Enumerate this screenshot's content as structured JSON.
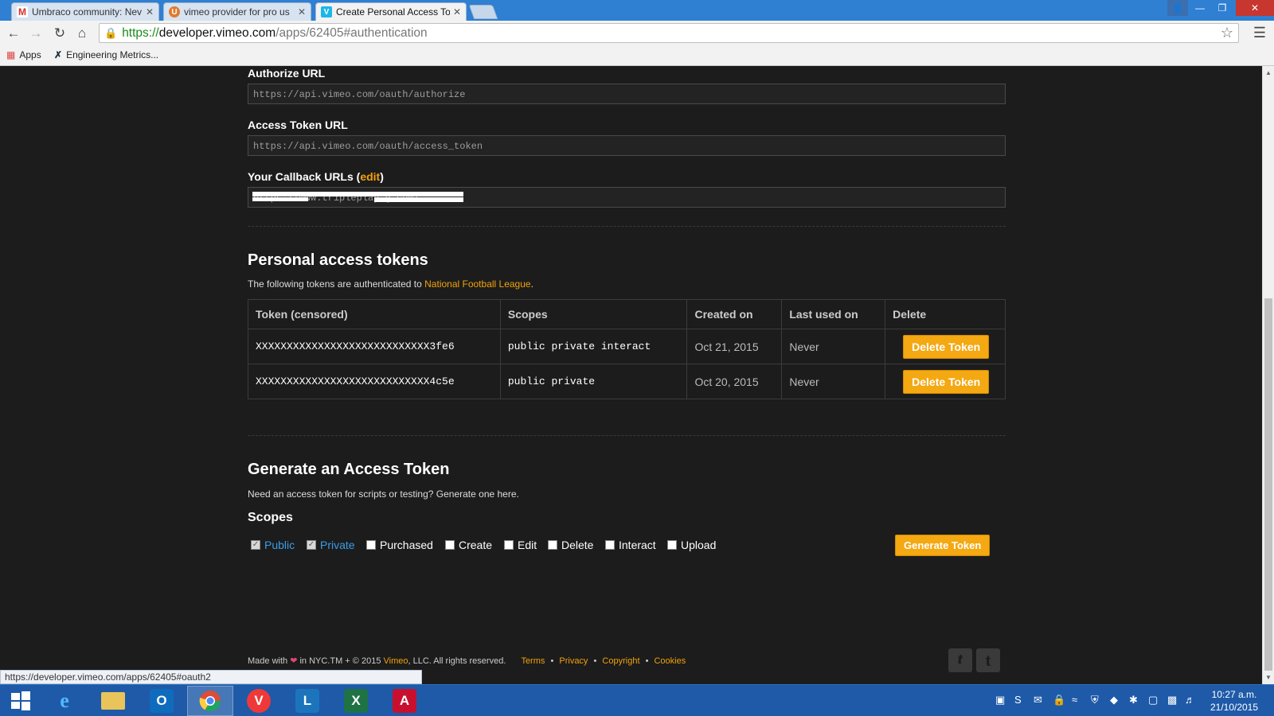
{
  "browser": {
    "tabs": [
      {
        "label": "Umbraco community: Nev",
        "icon": "gmail-icon",
        "active": false
      },
      {
        "label": "vimeo provider for pro us",
        "icon": "umbraco-icon",
        "active": false
      },
      {
        "label": "Create Personal Access To",
        "icon": "vimeo-icon",
        "active": true
      }
    ],
    "tab_close": "✕",
    "address": {
      "scheme": "https://",
      "host": "developer.vimeo.com",
      "path": "/apps/62405#authentication"
    },
    "bookmarks": [
      {
        "label": "Apps",
        "icon": "apps-grid-icon"
      },
      {
        "label": "Engineering Metrics...",
        "icon": "bookmark-x-icon"
      }
    ],
    "status_url": "https://developer.vimeo.com/apps/62405#oauth2"
  },
  "auth": {
    "authorize_label": "Authorize URL",
    "authorize_value": "https://api.vimeo.com/oauth/authorize",
    "access_token_label": "Access Token URL",
    "access_token_value": "https://api.vimeo.com/oauth/access_token",
    "callback_label": "Your Callback URLs (",
    "callback_edit": "edit",
    "callback_close": ")",
    "callback_value": "https://www.tripleplay.g.com/"
  },
  "tokens_section": {
    "title": "Personal access tokens",
    "desc_prefix": "The following tokens are authenticated to ",
    "desc_link": "National Football League",
    "desc_suffix": ".",
    "columns": [
      "Token (censored)",
      "Scopes",
      "Created on",
      "Last used on",
      "Delete"
    ],
    "rows": [
      {
        "token": "XXXXXXXXXXXXXXXXXXXXXXXXXXXX3fe6",
        "scopes": "public private interact",
        "created": "Oct 21, 2015",
        "last_used": "Never",
        "action": "Delete Token"
      },
      {
        "token": "XXXXXXXXXXXXXXXXXXXXXXXXXXXX4c5e",
        "scopes": "public private",
        "created": "Oct 20, 2015",
        "last_used": "Never",
        "action": "Delete Token"
      }
    ]
  },
  "generate_section": {
    "title": "Generate an Access Token",
    "desc": "Need an access token for scripts or testing? Generate one here.",
    "scopes_label": "Scopes",
    "scopes": [
      {
        "label": "Public",
        "checked": true
      },
      {
        "label": "Private",
        "checked": true
      },
      {
        "label": "Purchased",
        "checked": false
      },
      {
        "label": "Create",
        "checked": false
      },
      {
        "label": "Edit",
        "checked": false
      },
      {
        "label": "Delete",
        "checked": false
      },
      {
        "label": "Interact",
        "checked": false
      },
      {
        "label": "Upload",
        "checked": false
      }
    ],
    "button": "Generate Token"
  },
  "footer": {
    "made_with": "Made with",
    "in_nyc": " in NYC.",
    "rest": "TM + © 2015 ",
    "vimeo": "Vimeo",
    "llc": ", LLC. All rights reserved.",
    "links": [
      "Terms",
      "Privacy",
      "Copyright",
      "Cookies"
    ],
    "separator": "•"
  },
  "taskbar": {
    "clock_time": "10:27 a.m.",
    "clock_date": "21/10/2015",
    "apps": [
      "windows-start-icon",
      "internet-explorer-icon",
      "file-explorer-icon",
      "outlook-icon",
      "chrome-icon",
      "vivaldi-icon",
      "lync-icon",
      "excel-icon",
      "acrobat-icon"
    ]
  },
  "colors": {
    "accent": "#f4a812",
    "link": "#f1a20b",
    "checked_scope": "#3a9de8",
    "background": "#1c1c1c"
  }
}
